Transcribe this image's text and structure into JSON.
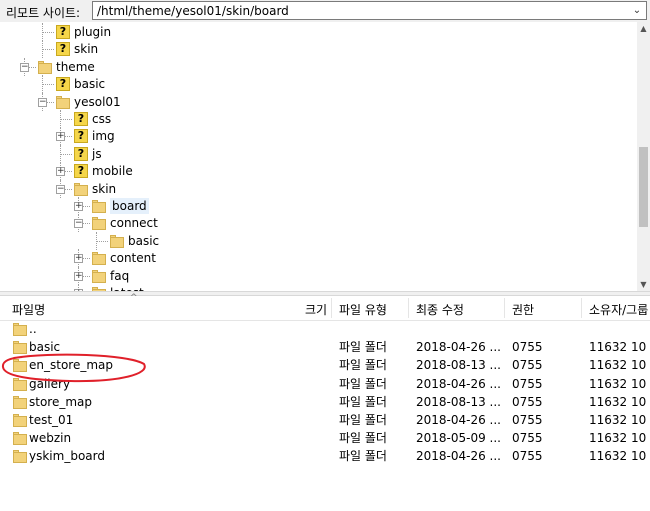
{
  "address_bar": {
    "label": "리모트 사이트:",
    "path": "/html/theme/yesol01/skin/board",
    "dropdown_icon": "chevron-down-icon"
  },
  "tree": {
    "nodes": [
      {
        "label": "plugin",
        "icon": "question-folder-icon"
      },
      {
        "label": "skin",
        "icon": "question-folder-icon"
      },
      {
        "label": "theme",
        "icon": "folder-icon",
        "expanded": true
      },
      {
        "label": "basic",
        "icon": "question-folder-icon"
      },
      {
        "label": "yesol01",
        "icon": "folder-icon",
        "expanded": true
      },
      {
        "label": "css",
        "icon": "question-folder-icon"
      },
      {
        "label": "img",
        "icon": "question-folder-icon",
        "collapsed": true
      },
      {
        "label": "js",
        "icon": "question-folder-icon"
      },
      {
        "label": "mobile",
        "icon": "question-folder-icon",
        "collapsed": true
      },
      {
        "label": "skin",
        "icon": "folder-icon",
        "expanded": true
      },
      {
        "label": "board",
        "icon": "folder-icon",
        "collapsed": true,
        "selected": true
      },
      {
        "label": "connect",
        "icon": "folder-icon",
        "expanded": true
      },
      {
        "label": "basic",
        "icon": "folder-icon"
      },
      {
        "label": "content",
        "icon": "folder-icon",
        "collapsed": true
      },
      {
        "label": "faq",
        "icon": "folder-icon",
        "collapsed": true
      },
      {
        "label": "latest",
        "icon": "folder-icon",
        "collapsed": true
      }
    ]
  },
  "file_list": {
    "columns": [
      "파일명",
      "크기",
      "파일 유형",
      "최종 수정",
      "권한",
      "소유자/그룹"
    ],
    "rows": [
      {
        "name": "..",
        "size": "",
        "type": "",
        "modified": "",
        "perm": "",
        "owner": ""
      },
      {
        "name": "basic",
        "size": "",
        "type": "파일 폴더",
        "modified": "2018-04-26 ...",
        "perm": "0755",
        "owner": "11632 10"
      },
      {
        "name": "en_store_map",
        "size": "",
        "type": "파일 폴더",
        "modified": "2018-08-13 ...",
        "perm": "0755",
        "owner": "11632 10"
      },
      {
        "name": "gallery",
        "size": "",
        "type": "파일 폴더",
        "modified": "2018-04-26 ...",
        "perm": "0755",
        "owner": "11632 10"
      },
      {
        "name": "store_map",
        "size": "",
        "type": "파일 폴더",
        "modified": "2018-08-13 ...",
        "perm": "0755",
        "owner": "11632 10"
      },
      {
        "name": "test_01",
        "size": "",
        "type": "파일 폴더",
        "modified": "2018-04-26 ...",
        "perm": "0755",
        "owner": "11632 10"
      },
      {
        "name": "webzin",
        "size": "",
        "type": "파일 폴더",
        "modified": "2018-05-09 ...",
        "perm": "0755",
        "owner": "11632 10"
      },
      {
        "name": "yskim_board",
        "size": "",
        "type": "파일 폴더",
        "modified": "2018-04-26 ...",
        "perm": "0755",
        "owner": "11632 10"
      }
    ]
  },
  "annotation": {
    "color": "#e0202a",
    "target": "en_store_map"
  }
}
